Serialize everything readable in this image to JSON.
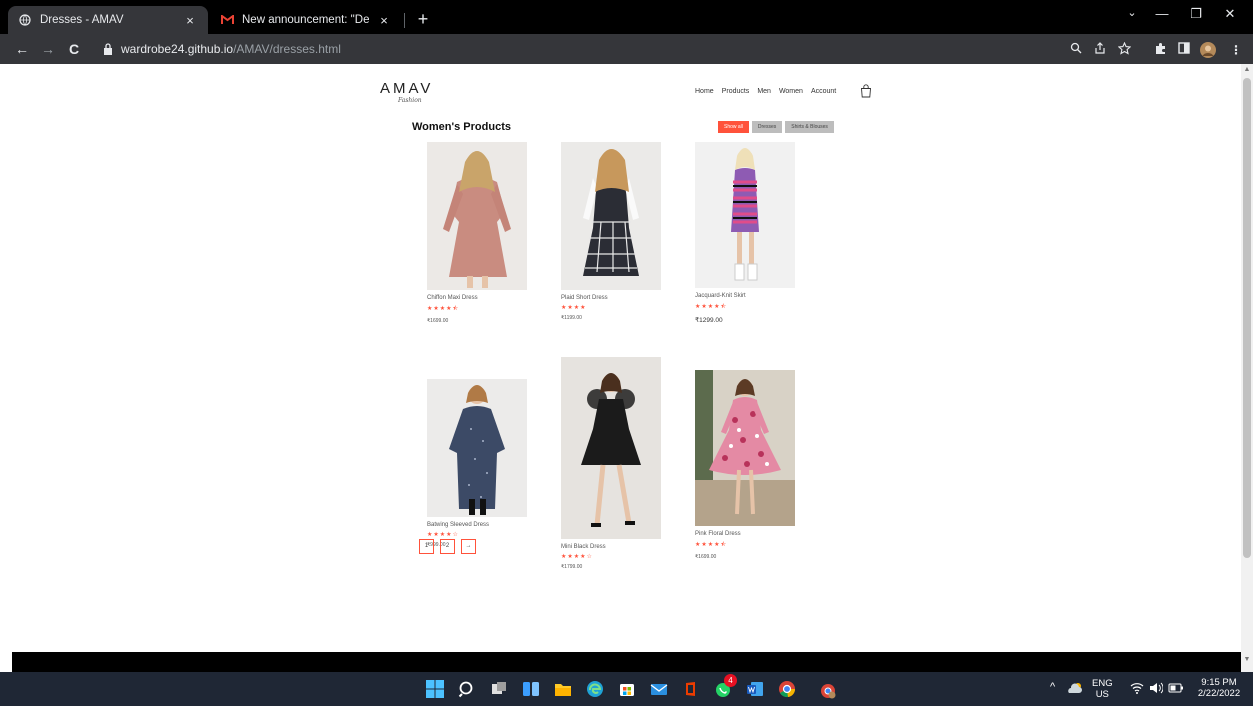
{
  "browser": {
    "tabs": [
      {
        "title": "Dresses - AMAV",
        "active": true
      },
      {
        "title": "New announcement: \"Dear stude",
        "active": false
      }
    ],
    "close_glyph": "×",
    "new_tab_glyph": "+",
    "window_controls": {
      "minimize": "—",
      "maximize": "❐",
      "close": "✕",
      "dropdown": "⌄"
    },
    "url_host": "wardrobe24.github.io",
    "url_path": "/AMAV/dresses.html",
    "nav": {
      "back": "←",
      "forward": "→",
      "reload": "C"
    }
  },
  "site": {
    "logo": "AMAV",
    "logo_sub": "Fashion",
    "nav": [
      "Home",
      "Products",
      "Men",
      "Women",
      "Account"
    ],
    "section_title": "Women's Products",
    "filters": [
      {
        "label": "Show all",
        "active": true
      },
      {
        "label": "Dresses",
        "active": false
      },
      {
        "label": "Shirts & Blouses",
        "active": false
      }
    ],
    "products": [
      {
        "name": "Chiffon Maxi Dress",
        "stars": "★★★★⯪",
        "price": "₹1699.00"
      },
      {
        "name": "Plaid Short Dress",
        "stars": "★★★★",
        "price": "₹1199.00"
      },
      {
        "name": "Jacquard-Knit Skirt",
        "stars": "★★★★⯪",
        "price": "₹1299.00"
      },
      {
        "name": "Batwing Sleeved Dress",
        "stars": "★★★★☆",
        "price": "₹999.00"
      },
      {
        "name": "Mini Black Dress",
        "stars": "★★★★☆",
        "price": "₹1799.00"
      },
      {
        "name": "Pink Floral Dress",
        "stars": "★★★★⯪",
        "price": "₹1699.00"
      }
    ],
    "pagination": [
      "1",
      "2",
      "→"
    ]
  },
  "taskbar": {
    "notification_badge": "4",
    "language": "ENG",
    "region": "US",
    "time": "9:15 PM",
    "date": "2/22/2022",
    "chevron": "^"
  },
  "colors": {
    "accent": "#ff523b",
    "chrome_dark": "#35363a",
    "taskbar": "#1f2735"
  }
}
